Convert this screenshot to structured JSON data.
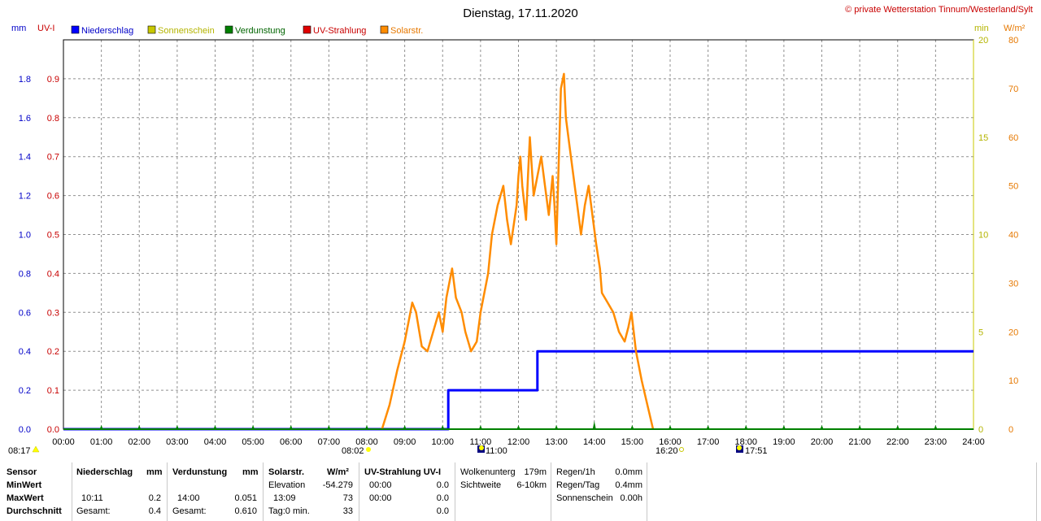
{
  "header": {
    "title": "Dienstag, 17.11.2020",
    "credit": "© private Wetterstation Tinnum/Westerland/Sylt"
  },
  "axes": {
    "left_unit_mm": "mm",
    "left_unit_uv": "UV-I",
    "right_unit_min": "min",
    "right_unit_wm2": "W/m²",
    "mm_ticks": [
      "0.0",
      "0.2",
      "0.4",
      "0.6",
      "0.8",
      "1.0",
      "1.2",
      "1.4",
      "1.6",
      "1.8"
    ],
    "uv_ticks": [
      "0.0",
      "0.1",
      "0.2",
      "0.3",
      "0.4",
      "0.5",
      "0.6",
      "0.7",
      "0.8",
      "0.9"
    ],
    "min_ticks": [
      "0",
      "5",
      "10",
      "15",
      "20"
    ],
    "wm2_ticks": [
      "0",
      "10",
      "20",
      "30",
      "40",
      "50",
      "60",
      "70",
      "80"
    ],
    "x_ticks": [
      "00:00",
      "01:00",
      "02:00",
      "03:00",
      "04:00",
      "05:00",
      "06:00",
      "07:00",
      "08:00",
      "09:00",
      "10:00",
      "11:00",
      "12:00",
      "13:00",
      "14:00",
      "15:00",
      "16:00",
      "17:00",
      "18:00",
      "19:00",
      "20:00",
      "21:00",
      "22:00",
      "23:00",
      "24:00"
    ]
  },
  "legend": [
    {
      "label": "Niederschlag",
      "color": "#0000ff",
      "text_color": "#0000c8"
    },
    {
      "label": "Sonnenschein",
      "color": "#c8c800",
      "text_color": "#b4b400"
    },
    {
      "label": "Verdunstung",
      "color": "#008000",
      "text_color": "#006400"
    },
    {
      "label": "UV-Strahlung",
      "color": "#e00000",
      "text_color": "#c80000"
    },
    {
      "label": "Solarstr.",
      "color": "#ff8c00",
      "text_color": "#e67800"
    }
  ],
  "sun_markers": {
    "sunrise": "08:17",
    "solar_start": "08:02",
    "moon_1": "11:00",
    "solar_end": "16:20",
    "moon_2": "17:51"
  },
  "chart_data": {
    "type": "line",
    "title": "Dienstag, 17.11.2020",
    "x_unit": "hours",
    "xlim": [
      0,
      24
    ],
    "axes": {
      "mm": [
        0,
        2.0
      ],
      "uv": [
        0,
        1.0
      ],
      "min": [
        0,
        20
      ],
      "wm2": [
        0,
        80
      ]
    },
    "grid": true,
    "legend_position": "top-left",
    "series": [
      {
        "name": "Niederschlag",
        "axis": "mm",
        "color": "#0000ff",
        "step": true,
        "points": [
          [
            0,
            0
          ],
          [
            10.15,
            0
          ],
          [
            10.15,
            0.2
          ],
          [
            12.5,
            0.2
          ],
          [
            12.5,
            0.4
          ],
          [
            24,
            0.4
          ]
        ]
      },
      {
        "name": "Solarstr.",
        "axis": "wm2",
        "color": "#ff8c00",
        "points": [
          [
            8.4,
            0
          ],
          [
            8.6,
            5
          ],
          [
            8.8,
            12
          ],
          [
            9.0,
            18
          ],
          [
            9.1,
            22
          ],
          [
            9.2,
            26
          ],
          [
            9.3,
            24
          ],
          [
            9.45,
            17
          ],
          [
            9.6,
            16
          ],
          [
            9.75,
            20
          ],
          [
            9.9,
            24
          ],
          [
            10.0,
            20
          ],
          [
            10.1,
            27
          ],
          [
            10.25,
            33
          ],
          [
            10.35,
            27
          ],
          [
            10.5,
            24
          ],
          [
            10.6,
            20
          ],
          [
            10.75,
            16
          ],
          [
            10.9,
            18
          ],
          [
            11.0,
            24
          ],
          [
            11.2,
            32
          ],
          [
            11.3,
            40
          ],
          [
            11.45,
            46
          ],
          [
            11.6,
            50
          ],
          [
            11.7,
            43
          ],
          [
            11.8,
            38
          ],
          [
            11.95,
            46
          ],
          [
            12.0,
            52
          ],
          [
            12.05,
            56
          ],
          [
            12.1,
            50
          ],
          [
            12.2,
            43
          ],
          [
            12.25,
            52
          ],
          [
            12.3,
            60
          ],
          [
            12.35,
            54
          ],
          [
            12.4,
            48
          ],
          [
            12.5,
            52
          ],
          [
            12.6,
            56
          ],
          [
            12.7,
            50
          ],
          [
            12.8,
            44
          ],
          [
            12.9,
            52
          ],
          [
            12.95,
            46
          ],
          [
            13.0,
            38
          ],
          [
            13.05,
            52
          ],
          [
            13.12,
            70
          ],
          [
            13.2,
            73
          ],
          [
            13.25,
            64
          ],
          [
            13.35,
            58
          ],
          [
            13.45,
            52
          ],
          [
            13.55,
            46
          ],
          [
            13.65,
            40
          ],
          [
            13.75,
            46
          ],
          [
            13.85,
            50
          ],
          [
            13.95,
            44
          ],
          [
            14.05,
            38
          ],
          [
            14.15,
            33
          ],
          [
            14.2,
            28
          ],
          [
            14.35,
            26
          ],
          [
            14.5,
            24
          ],
          [
            14.65,
            20
          ],
          [
            14.8,
            18
          ],
          [
            14.9,
            21
          ],
          [
            14.98,
            24
          ],
          [
            15.1,
            16
          ],
          [
            15.25,
            10
          ],
          [
            15.4,
            5
          ],
          [
            15.55,
            0
          ]
        ]
      },
      {
        "name": "Verdunstung",
        "axis": "mm",
        "color": "#008000",
        "hourly_marks": true,
        "points": [
          [
            0,
            0
          ],
          [
            24,
            0
          ]
        ]
      }
    ]
  },
  "stats": {
    "headers": {
      "sensor": "Sensor",
      "rain": "Niederschlag",
      "rain_unit": "mm",
      "evap": "Verdunstung",
      "evap_unit": "mm",
      "solar": "Solarstr.",
      "solar_unit": "W/m²",
      "uv": "UV-Strahlung UV-I"
    },
    "rows": {
      "min": "MinWert",
      "max": "MaxWert",
      "avg": "Durchschnitt"
    },
    "rain": {
      "max_time": "10:11",
      "max_val": "0.2",
      "total_label": "Gesamt:",
      "total_val": "0.4"
    },
    "evap": {
      "max_time": "14:00",
      "max_val": "0.051",
      "total_label": "Gesamt:",
      "total_val": "0.610"
    },
    "solar": {
      "elev_label": "Elevation",
      "elev_val": "-54.279",
      "max_time": "13:09",
      "max_val": "73",
      "avg_label": "Tag:0 min.",
      "avg_val": "33"
    },
    "uv": {
      "min_time": "00:00",
      "min_val": "0.0",
      "max_time": "00:00",
      "max_val": "0.0",
      "avg_val": "0.0"
    },
    "cloud": {
      "base_label": "Wolkenunterg",
      "base_val": "179m",
      "vis_label": "Sichtweite",
      "vis_val": "6-10km"
    },
    "rain_rate": {
      "hour_label": "Regen/1h",
      "hour_val": "0.0mm",
      "day_label": "Regen/Tag",
      "day_val": "0.4mm",
      "sun_label": "Sonnenschein",
      "sun_val": "0.00h"
    }
  }
}
